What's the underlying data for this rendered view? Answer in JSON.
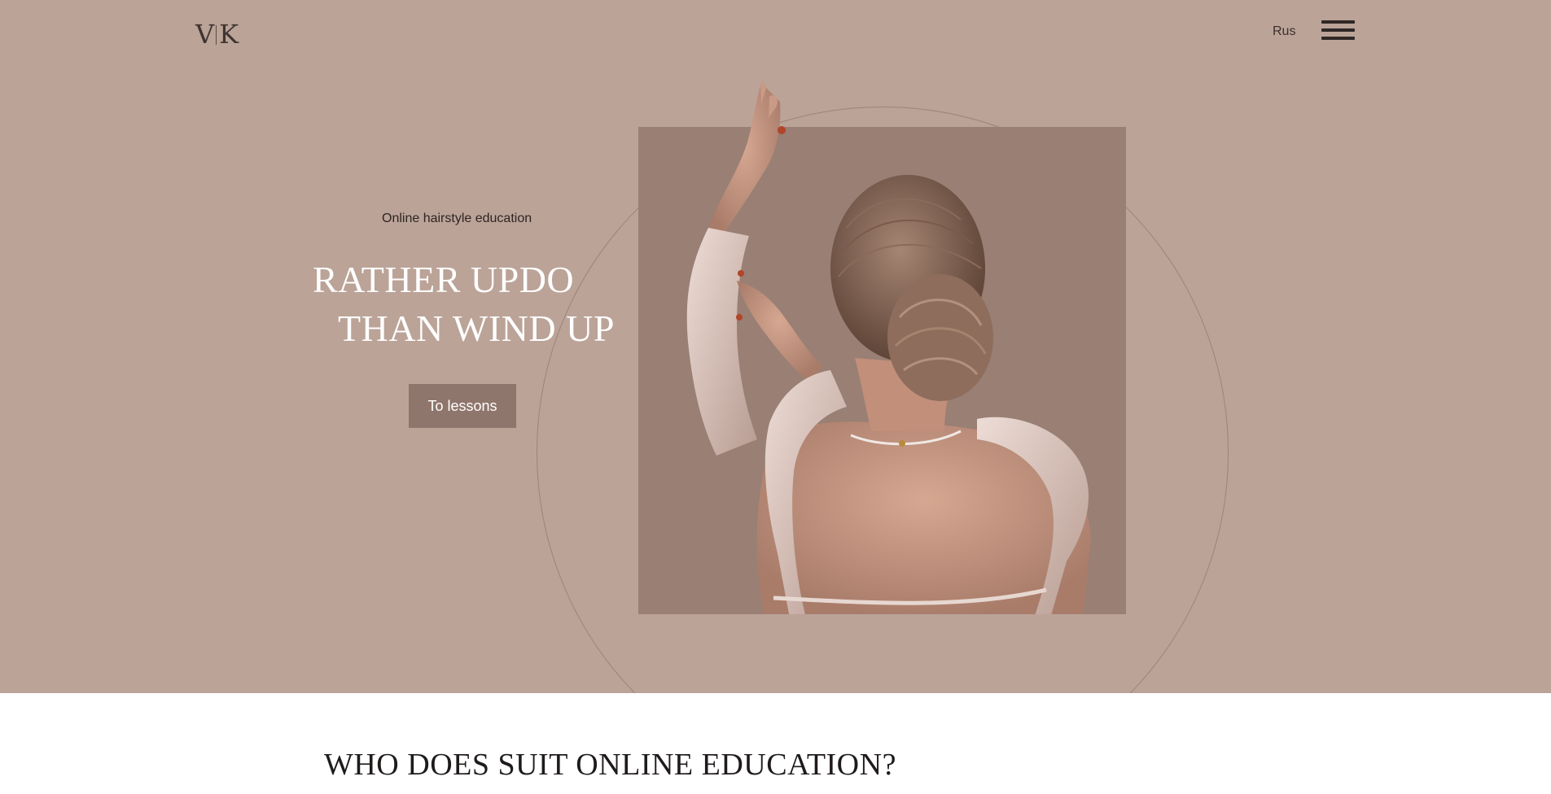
{
  "header": {
    "logo_left": "V",
    "logo_right": "K",
    "lang_label": "Rus",
    "menu_icon": "hamburger-menu-icon"
  },
  "hero": {
    "subtitle": "Online hairstyle education",
    "headline_line1": "RATHER UPDO",
    "headline_line2": "THAN WIND UP",
    "cta_label": "To lessons",
    "photo_subject": "woman-with-hair-bun-back-view"
  },
  "section": {
    "title": "WHO DOES SUIT ONLINE EDUCATION?"
  },
  "colors": {
    "hero_bg": "#bba398",
    "photo_bg": "#997f74",
    "button_bg": "#8f766c",
    "text_dark": "#2d2523",
    "page_bg": "#ffffff"
  }
}
